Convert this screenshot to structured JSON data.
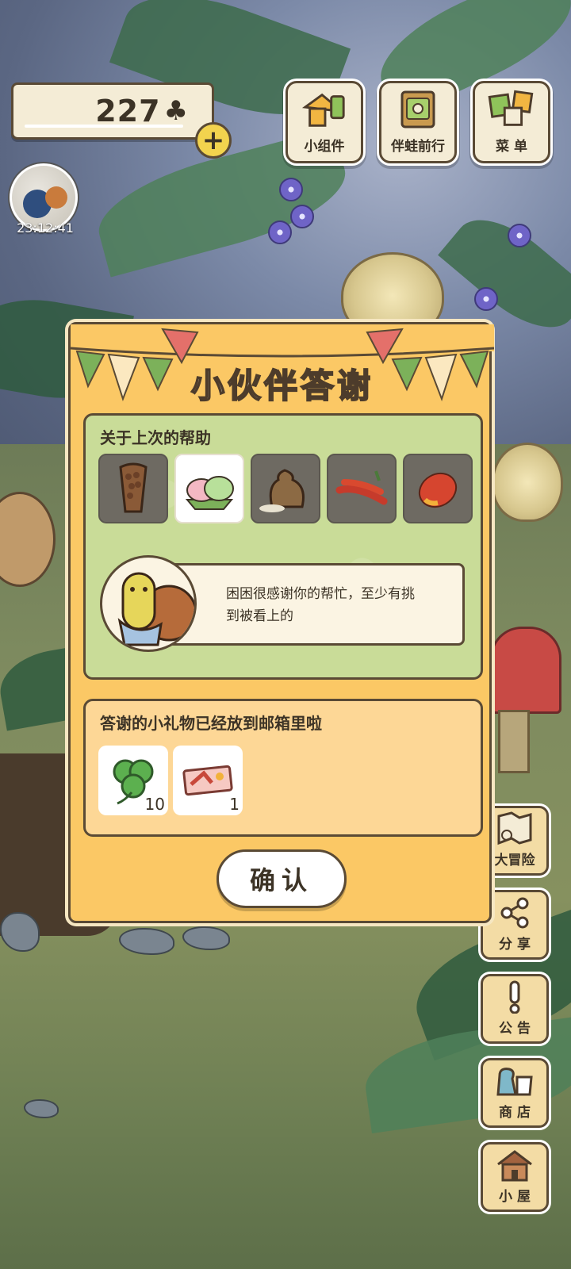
{
  "hud": {
    "clover_count": "227",
    "clover_glyph": "♣",
    "plus_label": "+",
    "timer": "23:12:41"
  },
  "top_buttons": [
    {
      "label": "小组件",
      "icon": "widget-icon"
    },
    {
      "label": "伴蛙前行",
      "icon": "journey-book-icon"
    },
    {
      "label": "菜 单",
      "icon": "menu-cards-icon"
    }
  ],
  "side_buttons": [
    {
      "label": "大冒险",
      "icon": "adventure-map-icon"
    },
    {
      "label": "分 享",
      "icon": "share-icon"
    },
    {
      "label": "公 告",
      "icon": "notice-icon"
    },
    {
      "label": "商 店",
      "icon": "shop-bags-icon"
    },
    {
      "label": "小 屋",
      "icon": "house-icon"
    }
  ],
  "dialog": {
    "title": "小伙伴答谢",
    "help_section": {
      "label": "关于上次的帮助",
      "foods": [
        {
          "icon": "chocolate-bread-icon",
          "selected": false
        },
        {
          "icon": "mochi-icon",
          "selected": true
        },
        {
          "icon": "rice-sack-icon",
          "selected": false
        },
        {
          "icon": "chili-peppers-icon",
          "selected": false
        },
        {
          "icon": "mango-icon",
          "selected": false
        }
      ],
      "message_line1": "困困很感谢你的帮忙，至少有挑",
      "message_line2": "到被看上的"
    },
    "gift_section": {
      "label": "答谢的小礼物已经放到邮箱里啦",
      "gifts": [
        {
          "icon": "clover-icon",
          "qty": "10"
        },
        {
          "icon": "ticket-icon",
          "qty": "1"
        }
      ]
    },
    "confirm_label": "确认"
  },
  "colors": {
    "dialog_bg": "#fbc865",
    "help_panel_bg": "#c9dc98",
    "gift_panel_bg": "#fdd796",
    "outline": "#5a4a35"
  }
}
